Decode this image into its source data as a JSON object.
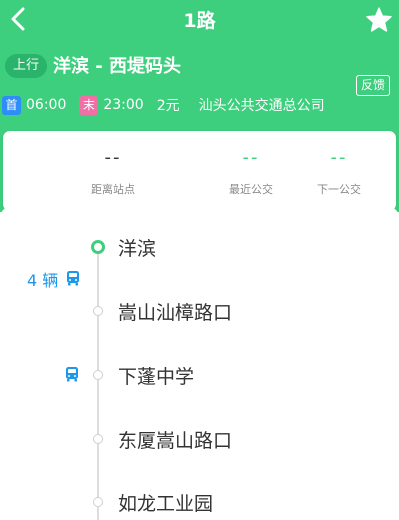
{
  "header": {
    "title": "1路",
    "direction_badge": "上行",
    "route_name": "洋滨 - 西堤码头",
    "feedback_label": "反馈",
    "first_tag": "首",
    "first_time": "06:00",
    "last_tag": "末",
    "last_time": "23:00",
    "fare": "2元",
    "company": "汕头公共交通总公司"
  },
  "stats": [
    {
      "value": "--",
      "label": "距离站点"
    },
    {
      "value": "--",
      "label": "最近公交"
    },
    {
      "value": "--",
      "label": "下一公交"
    }
  ],
  "stops": [
    {
      "name": "洋滨",
      "bus_count": "4 辆"
    },
    {
      "name": "嵩山汕樟路口",
      "bus_count": ""
    },
    {
      "name": "下蓬中学",
      "bus_count": ""
    },
    {
      "name": "东厦嵩山路口",
      "bus_count": ""
    },
    {
      "name": "如龙工业园",
      "bus_count": ""
    }
  ],
  "colors": {
    "header_green": "#3ecf7e",
    "accent_blue": "#1c97ea",
    "first_tag": "#2d8ef7",
    "last_tag": "#f06fa6"
  },
  "icons": [
    "back-arrow-icon",
    "star-icon",
    "bus-icon"
  ]
}
